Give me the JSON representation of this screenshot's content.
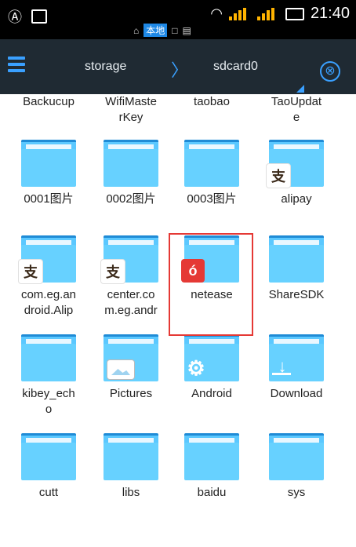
{
  "status_bar": {
    "time": "21:40",
    "sub_label": "本地",
    "icons": [
      "app-icon",
      "image-icon",
      "wifi-icon",
      "signal-icon",
      "signal-icon",
      "battery-icon"
    ]
  },
  "nav": {
    "breadcrumb": [
      "storage",
      "sdcard0"
    ],
    "separator": "〉",
    "close_icon": "⊗"
  },
  "top_row_labels": [
    {
      "line1": "Backucup",
      "line2": ""
    },
    {
      "line1": "WifiMaste",
      "line2": "rKey"
    },
    {
      "line1": "taobao",
      "line2": ""
    },
    {
      "line1": "TaoUpdat",
      "line2": "e"
    }
  ],
  "folders": [
    {
      "name_line1": "0001图片",
      "name_line2": "",
      "badge": ""
    },
    {
      "name_line1": "0002图片",
      "name_line2": "",
      "badge": ""
    },
    {
      "name_line1": "0003图片",
      "name_line2": "",
      "badge": ""
    },
    {
      "name_line1": "alipay",
      "name_line2": "",
      "badge": "alipay"
    },
    {
      "name_line1": "com.eg.an",
      "name_line2": "droid.Alip",
      "badge": "alipay"
    },
    {
      "name_line1": "center.co",
      "name_line2": "m.eg.andr",
      "badge": "alipay"
    },
    {
      "name_line1": "netease",
      "name_line2": "",
      "badge": "netease"
    },
    {
      "name_line1": "ShareSDK",
      "name_line2": "",
      "badge": ""
    },
    {
      "name_line1": "kibey_ech",
      "name_line2": "o",
      "badge": ""
    },
    {
      "name_line1": "Pictures",
      "name_line2": "",
      "badge": "pictures"
    },
    {
      "name_line1": "Android",
      "name_line2": "",
      "badge": "gear"
    },
    {
      "name_line1": "Download",
      "name_line2": "",
      "badge": "download"
    },
    {
      "name_line1": "cutt",
      "name_line2": "",
      "badge": ""
    },
    {
      "name_line1": "libs",
      "name_line2": "",
      "badge": ""
    },
    {
      "name_line1": "baidu",
      "name_line2": "",
      "badge": ""
    },
    {
      "name_line1": "sys",
      "name_line2": "",
      "badge": ""
    }
  ],
  "badge_glyphs": {
    "alipay": "支",
    "netease": "ó",
    "gear": "⚙",
    "download": "↓"
  },
  "colors": {
    "nav_bg": "#1f2a33",
    "accent": "#3aa0ff",
    "folder": "#67d1ff",
    "highlight": "#e53935"
  }
}
